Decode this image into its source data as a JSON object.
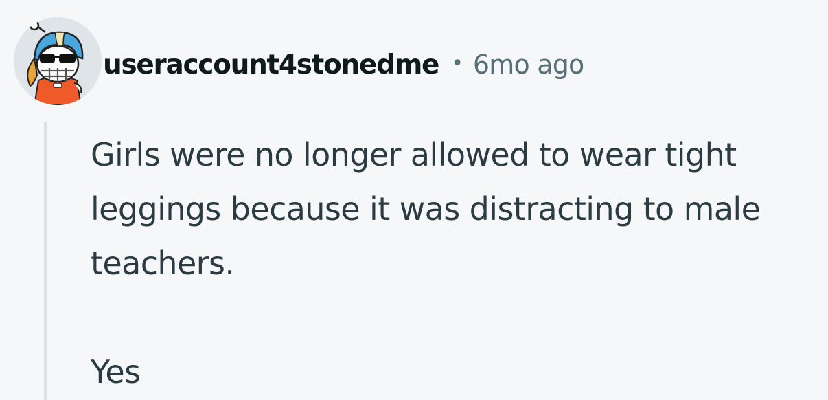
{
  "comment": {
    "author": "useraccount4stonedme",
    "separator": "•",
    "timestamp": "6mo ago",
    "avatar_icon": "snoo-avatar-football-helmet-sunglasses-icon",
    "paragraphs": [
      "Girls were no longer allowed to wear tight leggings because it was distracting to male teachers.",
      "Yes"
    ]
  },
  "colors": {
    "background": "#f6f7f8",
    "username": "#0f1a1c",
    "meta": "#576f76",
    "body_text": "#2a3c42",
    "thread_line": "#dbe0e6"
  }
}
